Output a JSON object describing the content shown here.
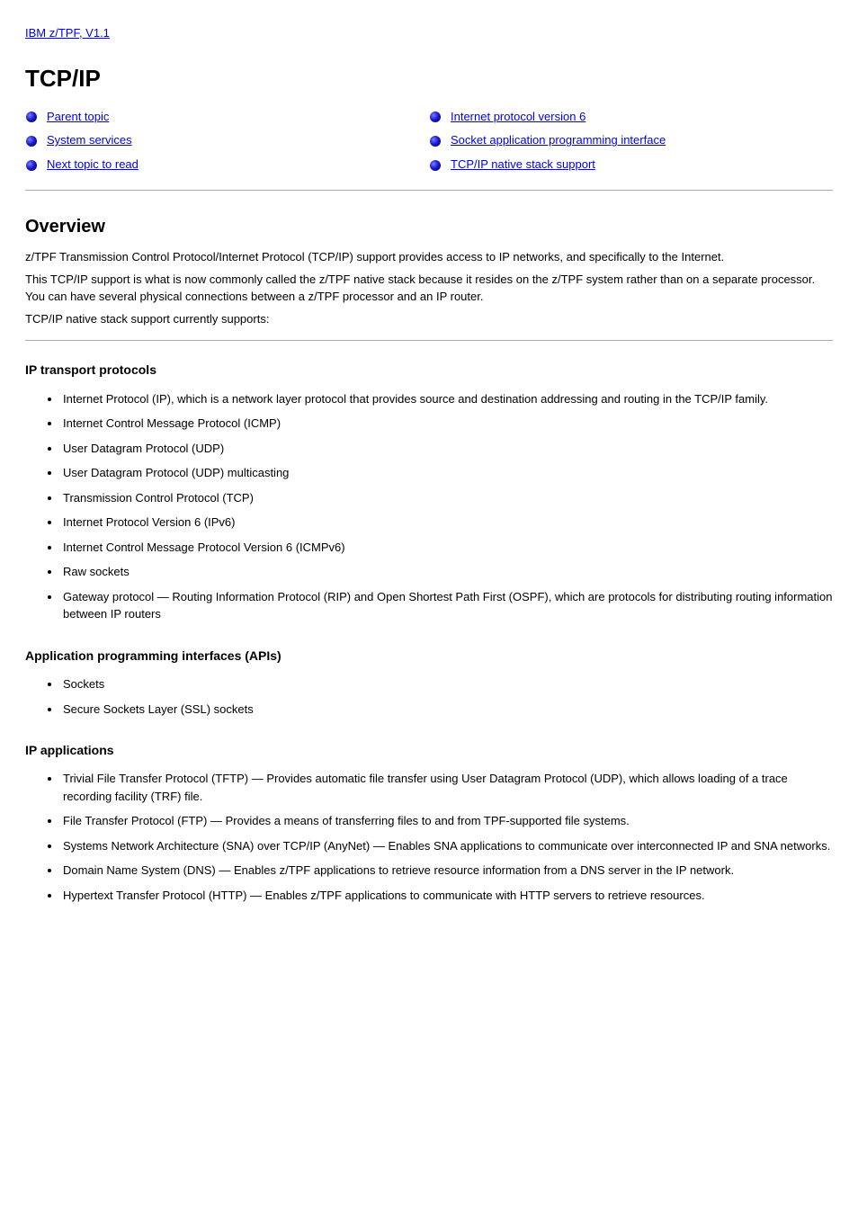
{
  "top_link": "IBM z/TPF, V1.1",
  "title": "TCP/IP",
  "nav": {
    "left": [
      "Parent topic",
      "System services",
      "Next topic to read"
    ],
    "right": [
      "Internet protocol version 6",
      "Socket application programming interface",
      "TCP/IP native stack support"
    ]
  },
  "overview": {
    "heading": "Overview",
    "p1": "z/TPF Transmission Control Protocol/Internet Protocol (TCP/IP) support provides access to IP networks, and specifically to the Internet.",
    "p2": "This TCP/IP support is what is now commonly called the z/TPF native stack because it resides on the z/TPF system rather than on a separate processor. You can have several physical connections between a z/TPF processor and an IP router.",
    "p3": "TCP/IP native stack support currently supports:"
  },
  "protocols": {
    "heading": "IP transport protocols",
    "items": [
      "Internet Protocol (IP), which is a network layer protocol that provides source and destination addressing and routing in the TCP/IP family.",
      "Internet Control Message Protocol (ICMP)",
      "User Datagram Protocol (UDP)",
      "User Datagram Protocol (UDP) multicasting",
      "Transmission Control Protocol (TCP)",
      "Internet Protocol Version 6 (IPv6)",
      "Internet Control Message Protocol Version 6 (ICMPv6)",
      "Raw sockets",
      "Gateway protocol — Routing Information Protocol (RIP) and Open Shortest Path First (OSPF), which are protocols for distributing routing information between IP routers"
    ]
  },
  "apis": {
    "heading": "Application programming interfaces (APIs)",
    "items": [
      "Sockets",
      "Secure Sockets Layer (SSL) sockets"
    ]
  },
  "apps": {
    "heading": "IP applications",
    "items": [
      "Trivial File Transfer Protocol (TFTP) — Provides automatic file transfer using User Datagram Protocol (UDP), which allows loading of a trace recording facility (TRF) file.",
      "File Transfer Protocol (FTP) — Provides a means of transferring files to and from TPF-supported file systems.",
      "Systems Network Architecture (SNA) over TCP/IP (AnyNet) — Enables SNA applications to communicate over interconnected IP and SNA networks.",
      "Domain Name System (DNS) — Enables z/TPF applications to retrieve resource information from a DNS server in the IP network.",
      "Hypertext Transfer Protocol (HTTP) — Enables z/TPF applications to communicate with HTTP servers to retrieve resources."
    ]
  }
}
